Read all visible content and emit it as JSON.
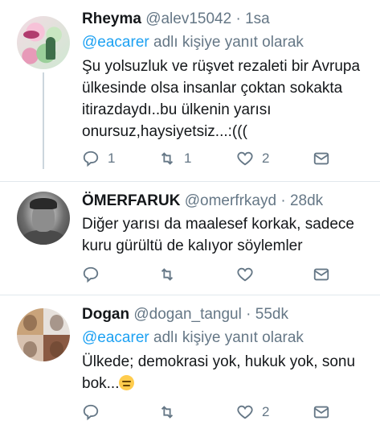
{
  "tweets": [
    {
      "name": "Rheyma",
      "handle": "@alev15042",
      "sep": "·",
      "time": "1sa",
      "reply_mention": "@eacarer",
      "reply_suffix": " adlı kişiye yanıt olarak",
      "text_lines": [
        "Şu yolsuzluk ve rüşvet rezaleti bir Avrupa",
        "ülkesinde olsa insanlar çoktan sokakta",
        "itirazdaydı..bu ülkenin yarısı",
        "onursuz,haysiyetsiz...:((("
      ],
      "reply_count": "1",
      "retweet_count": "1",
      "like_count": "2"
    },
    {
      "name": "ÖMERFARUK",
      "handle": "@omerfrkayd",
      "sep": "·",
      "time": "28dk",
      "text_lines": [
        "Diğer yarısı da maalesef korkak, sadece",
        "kuru gürültü de kalıyor söylemler"
      ]
    },
    {
      "name": "Dogan",
      "handle": "@dogan_tangul",
      "sep": "·",
      "time": "55dk",
      "reply_mention": "@eacarer",
      "reply_suffix": " adlı kişiye yanıt olarak",
      "text_lines": [
        "Ülkede; demokrasi yok, hukuk yok, sonu",
        "bok..."
      ],
      "like_count": "2"
    }
  ],
  "icons": {
    "reply": "reply-icon",
    "retweet": "retweet-icon",
    "like": "heart-icon",
    "dm": "envelope-icon",
    "emoji": "expressionless-face-emoji"
  },
  "colors": {
    "text": "#14171a",
    "secondary": "#657786",
    "link": "#1da1f2",
    "divider": "#e1e8ed"
  }
}
